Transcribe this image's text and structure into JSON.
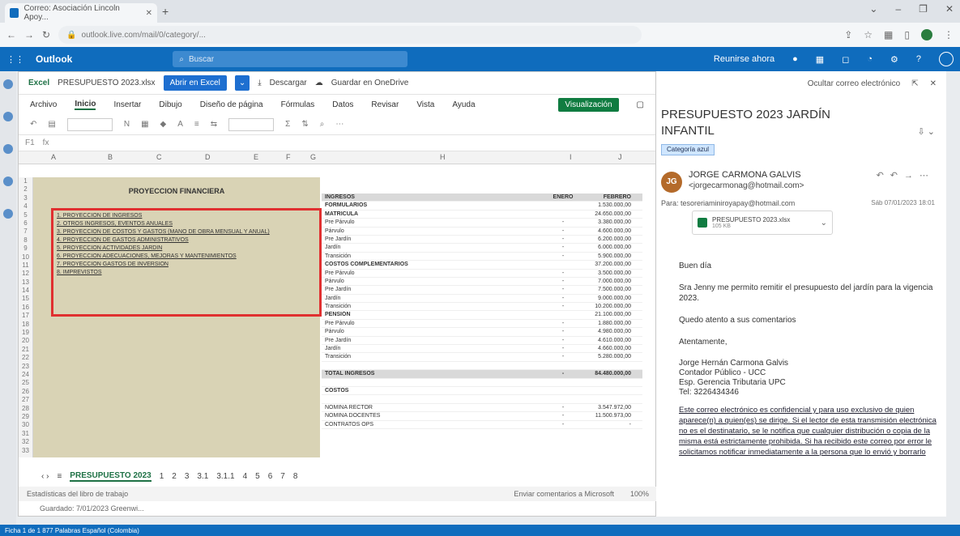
{
  "browser": {
    "tab_title": "Correo: Asociación Lincoln Apoy...",
    "url": "outlook.live.com/mail/0/category/...",
    "icons": [
      "back-icon",
      "forward-icon",
      "reload-icon",
      "lock-icon",
      "star-icon",
      "extensions-icon",
      "profile-icon"
    ]
  },
  "outlook": {
    "brand": "Outlook",
    "search_placeholder": "Buscar",
    "meeting_now": "Reunirse ahora"
  },
  "excel": {
    "app": "Excel",
    "file": "PRESUPUESTO 2023.xlsx",
    "open_desktop": "Abrir en Excel",
    "download": "Descargar",
    "save_onedrive": "Guardar en OneDrive",
    "menus": [
      "Archivo",
      "Inicio",
      "Insertar",
      "Dibujo",
      "Diseño de página",
      "Fórmulas",
      "Datos",
      "Revisar",
      "Vista",
      "Ayuda"
    ],
    "view_mode": "Visualización",
    "cell_ref": "F1",
    "fx": "fx",
    "col_letters": [
      "A",
      "B",
      "C",
      "D",
      "E",
      "F",
      "G",
      "H",
      "I",
      "J",
      "K"
    ],
    "left_title": "PROYECCION FINANCIERA",
    "links": [
      "1. PROYECCION DE INGRESOS",
      "2. OTROS INGRESOS, EVENTOS ANUALES",
      "3. PROYECCION DE COSTOS Y GASTOS (MANO DE OBRA MENSUAL Y ANUAL)",
      "4. PROYECCION DE GASTOS ADMINISTRATIVOS",
      "5. PROYECCION ACTIVIDADES JARDIN",
      "6. PROYECCION ADECUACIONES, MEJORAS Y MANTENIMIENTOS",
      "7. PROYECCION GASTOS DE INVERSION",
      "8. IMPREVISTOS"
    ],
    "table_header": [
      "INGRESOS",
      "ENERO",
      "FEBRERO"
    ],
    "rows": [
      {
        "label": "FORMULARIOS",
        "enero": "",
        "feb": "1.530.000,00",
        "kind": "sec"
      },
      {
        "label": "MATRICULA",
        "enero": "",
        "feb": "24.650.000,00",
        "kind": "sec"
      },
      {
        "label": "Pre Párvulo",
        "enero": "-",
        "feb": "3.380.000,00",
        "kind": "sub"
      },
      {
        "label": "Párvulo",
        "enero": "-",
        "feb": "4.600.000,00",
        "kind": "sub"
      },
      {
        "label": "Pre Jardín",
        "enero": "-",
        "feb": "6.200.000,00",
        "kind": "sub"
      },
      {
        "label": "Jardín",
        "enero": "-",
        "feb": "6.000.000,00",
        "kind": "sub"
      },
      {
        "label": "Transición",
        "enero": "-",
        "feb": "5.900.000,00",
        "kind": "sub"
      },
      {
        "label": "COSTOS COMPLEMENTARIOS",
        "enero": "",
        "feb": "37.200.000,00",
        "kind": "sec"
      },
      {
        "label": "Pre Párvulo",
        "enero": "-",
        "feb": "3.500.000,00",
        "kind": "sub"
      },
      {
        "label": "Párvulo",
        "enero": "-",
        "feb": "7.000.000,00",
        "kind": "sub"
      },
      {
        "label": "Pre Jardín",
        "enero": "-",
        "feb": "7.500.000,00",
        "kind": "sub"
      },
      {
        "label": "Jardín",
        "enero": "-",
        "feb": "9.000.000,00",
        "kind": "sub"
      },
      {
        "label": "Transición",
        "enero": "-",
        "feb": "10.200.000,00",
        "kind": "sub"
      },
      {
        "label": "PENSIÓN",
        "enero": "",
        "feb": "21.100.000,00",
        "kind": "sec"
      },
      {
        "label": "Pre Párvulo",
        "enero": "-",
        "feb": "1.880.000,00",
        "kind": "sub"
      },
      {
        "label": "Párvulo",
        "enero": "-",
        "feb": "4.980.000,00",
        "kind": "sub"
      },
      {
        "label": "Pre Jardín",
        "enero": "-",
        "feb": "4.610.000,00",
        "kind": "sub"
      },
      {
        "label": "Jardín",
        "enero": "-",
        "feb": "4.660.000,00",
        "kind": "sub"
      },
      {
        "label": "Transición",
        "enero": "-",
        "feb": "5.280.000,00",
        "kind": "sub"
      },
      {
        "label": "",
        "enero": "",
        "feb": "",
        "kind": "sub"
      },
      {
        "label": "TOTAL INGRESOS",
        "enero": "-",
        "feb": "84.480.000,00",
        "kind": "tot"
      },
      {
        "label": "",
        "enero": "",
        "feb": "",
        "kind": "sub"
      },
      {
        "label": "COSTOS",
        "enero": "",
        "feb": "",
        "kind": "sec"
      },
      {
        "label": "",
        "enero": "",
        "feb": "",
        "kind": "sub"
      },
      {
        "label": "NOMINA RECTOR",
        "enero": "-",
        "feb": "3.547.972,00",
        "kind": "sub"
      },
      {
        "label": "NOMINA DOCENTES",
        "enero": "-",
        "feb": "11.500.973,00",
        "kind": "sub"
      },
      {
        "label": "CONTRATOS OPS",
        "enero": "-",
        "feb": "-",
        "kind": "sub"
      }
    ],
    "sheet_tabs": [
      "PRESUPUESTO 2023",
      "1",
      "2",
      "3",
      "3.1",
      "3.1.1",
      "4",
      "5",
      "6",
      "7",
      "8"
    ],
    "status_left": "Estadísticas del libro de trabajo",
    "status_right": "Enviar comentarios a Microsoft",
    "zoom": "100%",
    "last_saved": "Guardado: 7/01/2023 Greenwi..."
  },
  "mail": {
    "hide_pane": "Ocultar correo electrónico",
    "subject": "PRESUPUESTO 2023 JARDÍN INFANTIL",
    "category": "Categoría azul",
    "avatar": "JG",
    "sender_name": "JORGE CARMONA GALVIS",
    "sender_email": "<jorgecarmonag@hotmail.com>",
    "to": "Para: tesoreriaminiroyapay@hotmail.com",
    "date": "Sáb 07/01/2023 18:01",
    "attachment_name": "PRESUPUESTO 2023.xlsx",
    "attachment_size": "105 KB",
    "greeting": "Buen día",
    "body1": "Sra Jenny me permito remitir el presupuesto del jardín para la vigencia 2023.",
    "body2": "Quedo atento a sus comentarios",
    "closing": "Atentamente,",
    "sig_name": "Jorge Hernán Carmona Galvis",
    "sig_title": "Contador Público - UCC",
    "sig_spec": "Esp. Gerencia Tributaria UPC",
    "sig_tel": "Tel: 3226434346",
    "disclaimer": "Este correo electrónico es confidencial y para uso exclusivo de quien aparece(n) a quien(es) se dirige. Si el lector de esta transmisión electrónica no es el destinatario, se le notifica que cualquier distribución o copia de la misma está estrictamente prohibida. Si ha recibido este correo por error le solicitamos notificar inmediatamente a la persona que lo envió y borrarlo"
  },
  "taskbar": {
    "left": "Ficha 1 de 1   877 Palabras   Español (Colombia)"
  }
}
